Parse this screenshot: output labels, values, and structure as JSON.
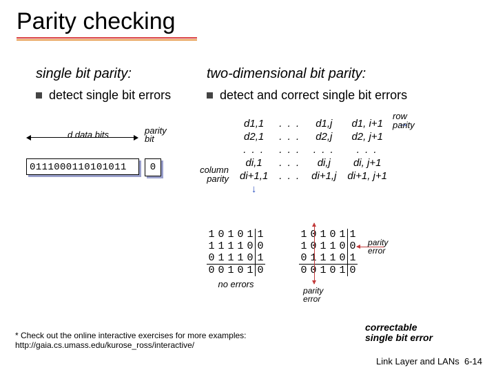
{
  "title": "Parity checking",
  "left": {
    "heading": "single bit parity:",
    "bullet": "detect single bit errors",
    "d_bits_label": "d data bits",
    "parity_bit_label": "parity\nbit",
    "data_bits": "0111000110101011",
    "parity_value": "0"
  },
  "right": {
    "heading": "two-dimensional bit parity:",
    "bullet": "detect and correct single bit errors",
    "row_parity_label": "row\nparity",
    "column_parity_label": "column\nparity",
    "matrix": {
      "r0": [
        "d1,1",
        ". . .",
        "d1,j",
        "d1, i+1"
      ],
      "r1": [
        "d2,1",
        ". . .",
        "d2,j",
        "d2, j+1"
      ],
      "r2": [
        ". . .",
        ". . .",
        ". . .",
        ". . ."
      ],
      "r3": [
        "di,1",
        ". . .",
        "di,j",
        "di, j+1"
      ],
      "r4": [
        "di+1,1",
        ". . .",
        "di+1,j",
        "di+1, j+1"
      ]
    }
  },
  "bottom": {
    "no_errors": {
      "rows": [
        [
          "1",
          "0",
          "1",
          "0",
          "1",
          "1"
        ],
        [
          "1",
          "1",
          "1",
          "1",
          "0",
          "0"
        ],
        [
          "0",
          "1",
          "1",
          "1",
          "0",
          "1"
        ],
        [
          "0",
          "0",
          "1",
          "0",
          "1",
          "0"
        ]
      ],
      "caption": "no errors"
    },
    "with_error": {
      "rows": [
        [
          "1",
          "0",
          "1",
          "0",
          "1",
          "1"
        ],
        [
          "1",
          "0",
          "1",
          "1",
          "0",
          "0"
        ],
        [
          "0",
          "1",
          "1",
          "1",
          "0",
          "1"
        ],
        [
          "0",
          "0",
          "1",
          "0",
          "1",
          "0"
        ]
      ],
      "caption": "parity\nerror",
      "parity_error_label_side": "parity\nerror",
      "parity_error_label_bottom": "parity\nerror"
    },
    "correctable_label": "correctable\nsingle bit error"
  },
  "footnote": {
    "text": "* Check out the online interactive exercises for more examples: ",
    "url": "http://gaia.cs.umass.edu/kurose_ross/interactive/"
  },
  "pagefoot": {
    "section": "Link Layer and LANs",
    "page": "6-14"
  }
}
